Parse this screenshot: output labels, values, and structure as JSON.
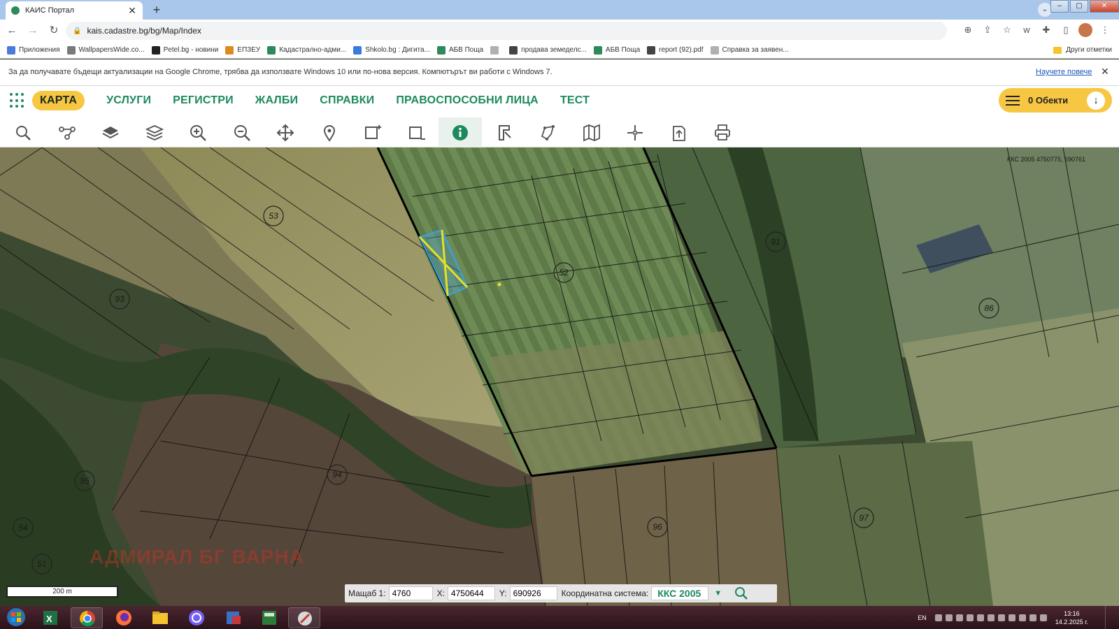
{
  "browser": {
    "tab_title": "КАИС Портал",
    "url": "kais.cadastre.bg/bg/Map/Index"
  },
  "bookmarks": [
    {
      "label": "Приложения",
      "color": "#4a7bd8"
    },
    {
      "label": "WallpapersWide.co...",
      "color": "#7a7a7a"
    },
    {
      "label": "Petel.bg - новини",
      "color": "#222222"
    },
    {
      "label": "ЕПЗЕУ",
      "color": "#e08a1e"
    },
    {
      "label": "Кадастрално-адми...",
      "color": "#2d8a5a"
    },
    {
      "label": "Shkolo.bg : Дигита...",
      "color": "#3a7be0"
    },
    {
      "label": "АБВ Поща",
      "color": "#2d8a5a"
    },
    {
      "label": "",
      "color": "#b0b0b0"
    },
    {
      "label": "продава земеделс...",
      "color": "#444444"
    },
    {
      "label": "АБВ Поща",
      "color": "#2d8a5a"
    },
    {
      "label": "report (92).pdf",
      "color": "#444444"
    },
    {
      "label": "Справка за заявен...",
      "color": "#b0b0b0"
    }
  ],
  "other_bookmarks": "Други отметки",
  "infobar": {
    "message": "За да получавате бъдещи актуализации на Google Chrome, трябва да използвате Windows 10 или по-нова версия. Компютърът ви работи с Windows 7.",
    "learn_more": "Научете повече"
  },
  "nav": {
    "items": [
      "КАРТА",
      "УСЛУГИ",
      "РЕГИСТРИ",
      "ЖАЛБИ",
      "СПРАВКИ",
      "ПРАВОСПОСОБНИ ЛИЦА",
      "ТЕСТ"
    ],
    "active_index": 0,
    "objects_label": "0 Обекти"
  },
  "tools": [
    {
      "name": "search-tool",
      "icon": "search-icon"
    },
    {
      "name": "route-tool",
      "icon": "route-icon"
    },
    {
      "name": "base-layers-tool",
      "icon": "layers-filled-icon"
    },
    {
      "name": "layers-tool",
      "icon": "layers-icon"
    },
    {
      "name": "zoom-in-tool",
      "icon": "zoom-in-icon"
    },
    {
      "name": "zoom-out-tool",
      "icon": "zoom-out-icon"
    },
    {
      "name": "pan-tool",
      "icon": "move-icon"
    },
    {
      "name": "location-tool",
      "icon": "map-pin-icon"
    },
    {
      "name": "select-area-tool",
      "icon": "select-plus-icon"
    },
    {
      "name": "deselect-area-tool",
      "icon": "select-minus-icon"
    },
    {
      "name": "info-tool",
      "icon": "info-icon",
      "active": true
    },
    {
      "name": "measure-tool",
      "icon": "measure-icon"
    },
    {
      "name": "polygon-tool",
      "icon": "polygon-icon"
    },
    {
      "name": "map-tool",
      "icon": "map-icon"
    },
    {
      "name": "coordinates-tool",
      "icon": "crosshair-icon"
    },
    {
      "name": "export-tool",
      "icon": "export-icon"
    },
    {
      "name": "print-tool",
      "icon": "print-icon"
    }
  ],
  "map": {
    "coord_readout": "ККС 2005 4750775, 690761",
    "scale_bar": "200 m",
    "watermark": "АДМИРАЛ БГ ВАРНА",
    "parcel_labels": [
      "53",
      "52",
      "93",
      "91",
      "86",
      "94",
      "95",
      "96",
      "97",
      "54",
      "51"
    ]
  },
  "map_controls": {
    "scale_label": "Мащаб 1:",
    "scale_value": "4760",
    "x_label": "X:",
    "x_value": "4750644",
    "y_label": "Y:",
    "y_value": "690926",
    "crs_label": "Координатна система:",
    "crs_value": "ККС 2005"
  },
  "taskbar": {
    "lang": "EN",
    "time": "13:16",
    "date": "14.2.2025 г."
  }
}
